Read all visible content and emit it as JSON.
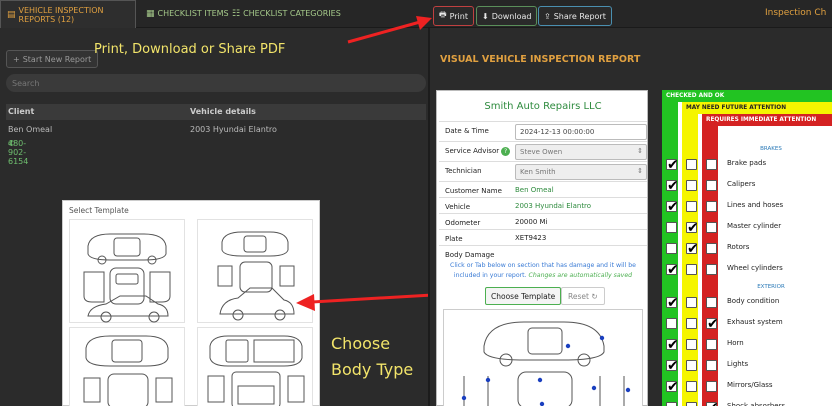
{
  "tabs": {
    "reports": "VEHICLE INSPECTION REPORTS (12)",
    "checklist_items": "CHECKLIST ITEMS",
    "checklist_categories": "CHECKLIST CATEGORIES"
  },
  "actions": {
    "print": "Print",
    "download": "Download",
    "share": "Share Report"
  },
  "top_right_title": "Inspection Ch",
  "left": {
    "start_button": "Start New Report",
    "search_placeholder": "Search",
    "columns": [
      "Client",
      "Vehicle details"
    ],
    "row": {
      "client": "Ben Omeal",
      "phone": "480-902-6154",
      "vehicle": "2003 Hyundai Elantro"
    }
  },
  "annotations": {
    "print_note": "Print, Download or Share  PDF",
    "body_type_line1": "Choose",
    "body_type_line2": "Body Type"
  },
  "template_panel": {
    "label": "Select Template"
  },
  "report": {
    "title": "VISUAL VEHICLE INSPECTION REPORT",
    "company": "Smith Auto Repairs LLC",
    "fields": [
      {
        "label": "Date & Time",
        "value": "2024-12-13 00:00:00"
      },
      {
        "label": "Service Advisor",
        "value": "Steve Owen"
      },
      {
        "label": "Technician",
        "value": "Ken Smith"
      },
      {
        "label": "Customer Name",
        "value": "Ben Omeal"
      },
      {
        "label": "Vehicle",
        "value": "2003 Hyundai Elantro"
      },
      {
        "label": "Odometer",
        "value": "20000 Mi"
      },
      {
        "label": "Plate",
        "value": "XET9423"
      },
      {
        "label": "Body Damage",
        "value": ""
      }
    ],
    "damage_note": "Click or Tab below on section that has damage and it will be included in your report.",
    "damage_note_saved": "Changes are automatically saved",
    "choose_template": "Choose Template",
    "reset": "Reset"
  },
  "checklist": {
    "legend": {
      "ok": "CHECKED AND OK",
      "future": "MAY NEED FUTURE ATTENTION",
      "immediate": "REQUIRES IMMEDIATE ATTENTION"
    },
    "colors": {
      "green": "#22c322",
      "yellow": "#f5f500",
      "red": "#d42222"
    },
    "sections": [
      {
        "name": "BRAKES",
        "items": [
          {
            "label": "Brake pads",
            "status": 0
          },
          {
            "label": "Calipers",
            "status": 0
          },
          {
            "label": "Lines and hoses",
            "status": 0
          },
          {
            "label": "Master cylinder",
            "status": 1
          },
          {
            "label": "Rotors",
            "status": 1
          },
          {
            "label": "Wheel cylinders",
            "status": 0
          }
        ]
      },
      {
        "name": "EXTERIOR",
        "items": [
          {
            "label": "Body condition",
            "status": 0
          },
          {
            "label": "Exhaust system",
            "status": 2
          },
          {
            "label": "Horn",
            "status": 0
          },
          {
            "label": "Lights",
            "status": 0
          },
          {
            "label": "Mirrors/Glass",
            "status": 0
          },
          {
            "label": "Shock absorbers",
            "status": 2
          }
        ]
      }
    ]
  }
}
